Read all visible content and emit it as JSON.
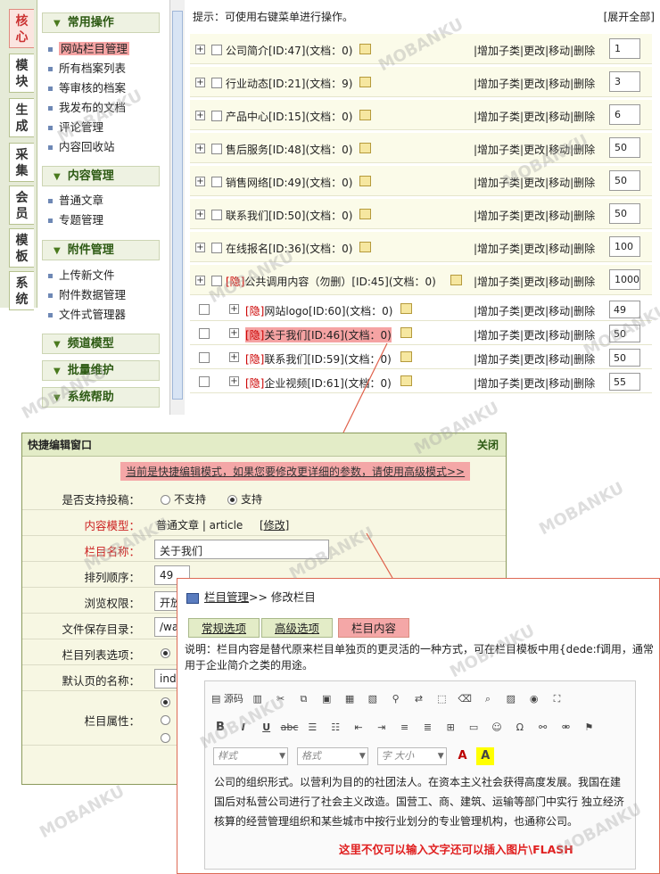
{
  "vtabs": [
    "核心",
    "模块",
    "生成",
    "采集",
    "会员",
    "模板",
    "系统"
  ],
  "menu": {
    "sections": [
      {
        "title": "常用操作",
        "items": [
          "网站栏目管理",
          "所有档案列表",
          "等审核的档案",
          "我发布的文档",
          "评论管理",
          "内容回收站"
        ]
      },
      {
        "title": "内容管理",
        "items": [
          "普通文章",
          "专题管理"
        ]
      },
      {
        "title": "附件管理",
        "items": [
          "上传新文件",
          "附件数据管理",
          "文件式管理器"
        ]
      },
      {
        "title": "频道模型",
        "items": []
      },
      {
        "title": "批量维护",
        "items": []
      },
      {
        "title": "系统帮助",
        "items": []
      }
    ],
    "icons": {
      "plus": "＋",
      "delete": "✕"
    }
  },
  "content": {
    "hint": "提示：可使用右键菜单进行操作。",
    "expand": "[展开全部]",
    "actions": "|增加子类|更改|移动|删除",
    "rows": [
      {
        "hidden": "",
        "name": "公司简介[ID:47](文档：0)",
        "order": "1"
      },
      {
        "hidden": "",
        "name": "行业动态[ID:21](文档：9)",
        "order": "3"
      },
      {
        "hidden": "",
        "name": "产品中心[ID:15](文档：0)",
        "order": "6"
      },
      {
        "hidden": "",
        "name": "售后服务[ID:48](文档：0)",
        "order": "50"
      },
      {
        "hidden": "",
        "name": "销售网络[ID:49](文档：0)",
        "order": "50"
      },
      {
        "hidden": "",
        "name": "联系我们[ID:50](文档：0)",
        "order": "50"
      },
      {
        "hidden": "",
        "name": "在线报名[ID:36](文档：0)",
        "order": "100"
      },
      {
        "hidden": "[隐]",
        "name": "公共调用内容（勿删）[ID:45](文档：0)",
        "order": "1000"
      }
    ],
    "subrows": [
      {
        "hidden": "[隐]",
        "name": "网站logo[ID:60](文档：0)",
        "order": "49"
      },
      {
        "hidden": "[隐]",
        "name": "关于我们[ID:46](文档：0)",
        "order": "50"
      },
      {
        "hidden": "[隐]",
        "name": "联系我们[ID:59](文档：0)",
        "order": "50"
      },
      {
        "hidden": "[隐]",
        "name": "企业视频[ID:61](文档：0)",
        "order": "55"
      }
    ]
  },
  "quick_edit": {
    "title": "快捷编辑窗口",
    "close": "关闭",
    "notice": "当前是快捷编辑模式，如果您要修改更详细的参数，请使用高级模式>>",
    "support_label": "是否支持投稿：",
    "support_no": "不支持",
    "support_yes": "支持",
    "model_label": "内容模型：",
    "model_value": "普通文章 | article",
    "model_change": "[修改]",
    "name_label": "栏目名称：",
    "name_value": "关于我们",
    "order_label": "排列顺序：",
    "order_value": "49",
    "browse_label": "浏览权限：",
    "browse_value": "开放",
    "dir_label": "文件保存目录：",
    "dir_value": "/wa",
    "list_label": "栏目列表选项：",
    "default_label": "默认页的名称：",
    "default_value": "inde",
    "attr_label": "栏目属性："
  },
  "edit_column": {
    "breadcrumb_link": "栏目管理",
    "breadcrumb_rest": ">> 修改栏目",
    "tabs": [
      "常规选项",
      "高级选项",
      "栏目内容"
    ],
    "desc": "说明：栏目内容是替代原来栏目单独页的更灵活的一种方式，可在栏目模板中用{dede:f调用，通常用于企业简介之类的用途。",
    "toolbar_source": "源码",
    "sel_style": "样式",
    "sel_format": "格式",
    "sel_size": "字 大小",
    "body": "公司的组织形式。以营利为目的的社团法人。在资本主义社会获得高度发展。我国在建国后对私营公司进行了社会主义改造。国营工、商、建筑、运输等部门中实行 独立经济核算的经营管理组织和某些城市中按行业划分的专业管理机构，也通称公司。",
    "red_tip": "这里不仅可以输入文字还可以插入图片\\FLASH"
  },
  "watermark": "MOBANKU"
}
